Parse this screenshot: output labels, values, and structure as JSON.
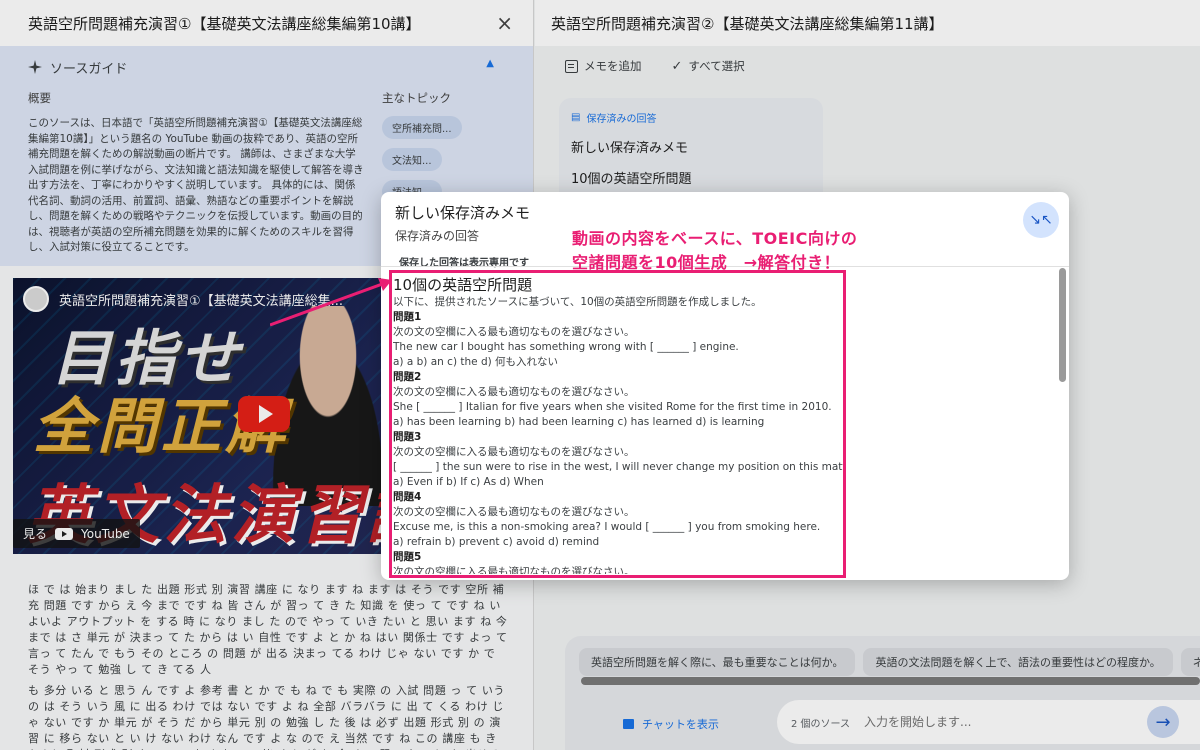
{
  "left": {
    "title": "英語空所問題補充演習①【基礎英文法講座総集編第10講】",
    "close_icon": "×",
    "source_guide": {
      "label": "ソースガイド",
      "summary_label": "概要",
      "summary_text": "このソースは、日本語で「英語空所問題補充演習①【基礎英文法講座総集編第10講】」という題名の YouTube 動画の抜粋であり、英語の空所補充問題を解くための解説動画の断片です。 講師は、さまざまな大学入試問題を例に挙げながら、文法知識と語法知識を駆使して解答を導き出す方法を、丁寧にわかりやすく説明しています。 具体的には、関係代名詞、動詞の活用、前置詞、語彙、熟語などの重要ポイントを解説し、問題を解くための戦略やテクニックを伝授しています。動画の目的は、視聴者が英語の空所補充問題を効果的に解くためのスキルを習得し、入試対策に役立てることです。",
      "topics_label": "主なトピック",
      "topics": [
        "空所補充問...",
        "文法知...",
        "語法知..."
      ]
    },
    "video": {
      "title": "英語空所問題補充演習①【基礎英文法講座総集...",
      "line1": "目指せ",
      "line2": "全問正解",
      "line3": "英文法演習講",
      "watch_label": "見る",
      "youtube_label": "YouTube"
    },
    "transcript": [
      "ほ で は 始まり まし た 出題 形式 別 演習 講座 に なり ます ね ます は そう です 空所 補充 問題 です から え 今 まで です ね 皆 さん が 習っ て き た 知識 を 使っ て です ね いよいよ アウトプット を する 時 に なり まし た ので やっ て いき たい と 思い ます ね 今 まで は さ 単元 が 決まっ て た から は い 自性 です よ と か ね はい 関係士 です よっ て 言っ て たん で もう その ところ の 問題 が 出る 決まっ てる わけ じゃ ない です か で そう やっ て 勉強 し て き てる 人",
      "も 多分 いる と 思う ん です よ 参考 書 と か で も ね で も 実際 の 入試 問題 っ て いう の は そう いう 風 に 出る わけ では ない です よ ね 全部 バラバラ に 出 て くる わけ じゃ ない です か 単元 が そう だ から 単元 別 の 勉強 し た 後 は 必ず 出題 形式 別 の 演習 に 移ら ない と い け ない わけ なん です よ な ので え 当然 です ね この 講座 も きちんと 取材 形式 別 やっ て いき ます ので 皆 さん が ね 今 まで 習っ た こと を 出せる よう に し て み て ください はい で は ま"
    ]
  },
  "right": {
    "title": "英語空所問題補充演習②【基礎英文法講座総集編第11講】",
    "toolbar": {
      "add_note": "メモを追加",
      "select_all": "すべて選択"
    },
    "saved": {
      "header": "保存済みの回答",
      "items": [
        "新しい保存済みメモ",
        "10個の英語空所問題"
      ]
    },
    "chat": {
      "suggestions": [
        "英語空所問題を解く際に、最も重要なことは何か。",
        "英語の文法問題を解く上で、語法の重要性はどの程度か。",
        "ネイ"
      ],
      "show_chat": "チャットを表示",
      "source_count": "2 個のソース",
      "input_placeholder": "入力を開始します...",
      "send_icon": "→"
    }
  },
  "modal": {
    "title": "新しい保存済みメモ",
    "subtitle": "保存済みの回答",
    "readonly_note": "保存した回答は表示専用です",
    "collapse_icon": "↘↖",
    "body_title": "10個の英語空所問題",
    "intro": "以下に、提供されたソースに基づいて、10個の英語空所問題を作成しました。",
    "questions": [
      {
        "label": "問題1",
        "instruction": "次の文の空欄に入る最も適切なものを選びなさい。",
        "sentence": "The new car I bought has something wrong with [ ______ ] engine.",
        "choices": "a) a b) an c) the d) 何も入れない"
      },
      {
        "label": "問題2",
        "instruction": "次の文の空欄に入る最も適切なものを選びなさい。",
        "sentence": "She [ ______ ] Italian for five years when she visited Rome for the first time in 2010.",
        "choices": "a) has been learning b) had been learning c) has learned d) is learning"
      },
      {
        "label": "問題3",
        "instruction": "次の文の空欄に入る最も適切なものを選びなさい。",
        "sentence": "[ ______ ] the sun were to rise in the west, I will never change my position on this matter.",
        "choices": "a) Even if b) If c) As d) When"
      },
      {
        "label": "問題4",
        "instruction": "次の文の空欄に入る最も適切なものを選びなさい。",
        "sentence": "Excuse me, is this a non-smoking area? I would [ ______ ] you from smoking here.",
        "choices": "a) refrain b) prevent c) avoid d) remind"
      },
      {
        "label": "問題5",
        "instruction": "次の文の空欄に入る最も適切なものを選びなさい。",
        "sentence": "",
        "choices": ""
      }
    ]
  },
  "annotation": {
    "line1": "動画の内容をベースに、TOEIC向けの",
    "line2": "空諸問題を10個生成　→解答付き！",
    "color": "#e91e73"
  }
}
